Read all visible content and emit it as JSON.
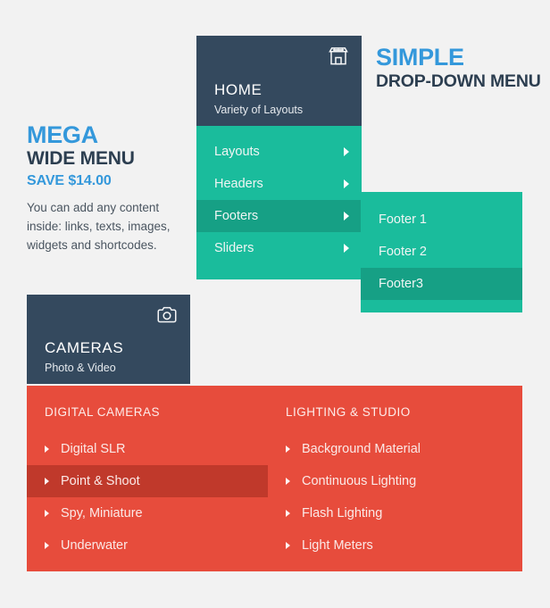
{
  "promo_left": {
    "line1": "MEGA",
    "line2": "WIDE MENU",
    "line3": "SAVE $14.00",
    "body": "You can add any content inside: links, texts, images, widgets and shortcodes."
  },
  "promo_right": {
    "line1": "SIMPLE",
    "line2": "DROP-DOWN MENU"
  },
  "cards": {
    "home": {
      "title": "HOME",
      "subtitle": "Variety of Layouts",
      "icon": "storefront-icon"
    },
    "cameras": {
      "title": "CAMERAS",
      "subtitle": "Photo & Video",
      "icon": "camera-icon"
    }
  },
  "main_menu": {
    "items": [
      {
        "label": "Layouts",
        "active": false,
        "has_submenu": true
      },
      {
        "label": "Headers",
        "active": false,
        "has_submenu": true
      },
      {
        "label": "Footers",
        "active": true,
        "has_submenu": true
      },
      {
        "label": "Sliders",
        "active": false,
        "has_submenu": true
      }
    ]
  },
  "submenu": {
    "items": [
      {
        "label": "Footer 1",
        "active": false
      },
      {
        "label": "Footer 2",
        "active": false
      },
      {
        "label": "Footer3",
        "active": true
      }
    ]
  },
  "mega_panel": {
    "columns": [
      {
        "heading": "DIGITAL CAMERAS",
        "items": [
          {
            "label": "Digital SLR",
            "active": false
          },
          {
            "label": "Point & Shoot",
            "active": true
          },
          {
            "label": "Spy, Miniature",
            "active": false
          },
          {
            "label": "Underwater",
            "active": false
          }
        ]
      },
      {
        "heading": "LIGHTING & STUDIO",
        "items": [
          {
            "label": "Background Material",
            "active": false
          },
          {
            "label": "Continuous Lighting",
            "active": false
          },
          {
            "label": "Flash Lighting",
            "active": false
          },
          {
            "label": "Light Meters",
            "active": false
          }
        ]
      }
    ]
  },
  "colors": {
    "background": "#f2f2f2",
    "dark": "#34495e",
    "teal": "#1abc9c",
    "teal_active": "#16a085",
    "red": "#e74c3c",
    "red_active": "#c0392b",
    "accent_blue": "#3498db",
    "heading_dark": "#2c3e50"
  }
}
